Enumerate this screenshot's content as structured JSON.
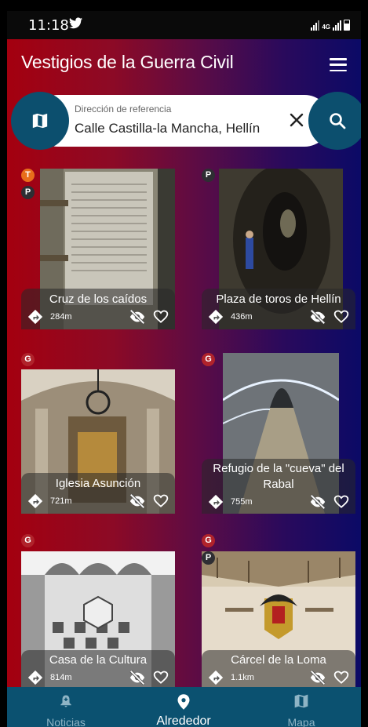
{
  "status": {
    "time": "11:18",
    "network": "4G"
  },
  "header": {
    "title": "Vestigios de la Guerra Civil"
  },
  "search": {
    "label": "Dirección de referencia",
    "value": "Calle Castilla-la Mancha, Hellín"
  },
  "places": [
    {
      "name": "Cruz de los caídos",
      "distance": "284m",
      "badges": [
        "T",
        "P"
      ]
    },
    {
      "name": "Plaza de toros de Hellín",
      "distance": "436m",
      "badges": [
        "P"
      ]
    },
    {
      "name": "Iglesia Asunción",
      "distance": "721m",
      "badges": [
        "G"
      ]
    },
    {
      "name": "Refugio de la \"cueva\" del Rabal",
      "distance": "755m",
      "badges": [
        "G"
      ]
    },
    {
      "name": "Casa de la Cultura",
      "distance": "814m",
      "badges": [
        "G"
      ]
    },
    {
      "name": "Cárcel de la Loma",
      "distance": "1.1km",
      "badges": [
        "G",
        "P"
      ]
    }
  ],
  "bottom_nav": [
    {
      "label": "Noticias",
      "icon": "bell-icon"
    },
    {
      "label": "Alrededor",
      "icon": "location-pin-icon",
      "active": true
    },
    {
      "label": "Mapa",
      "icon": "map-icon"
    }
  ],
  "colors": {
    "accent": "#0c4f6e",
    "nav": "#0b5170",
    "gradient_left": "#a4000f",
    "gradient_right": "#0b0a66",
    "badge_orange": "#e86e1b",
    "badge_red": "#b0232b"
  }
}
